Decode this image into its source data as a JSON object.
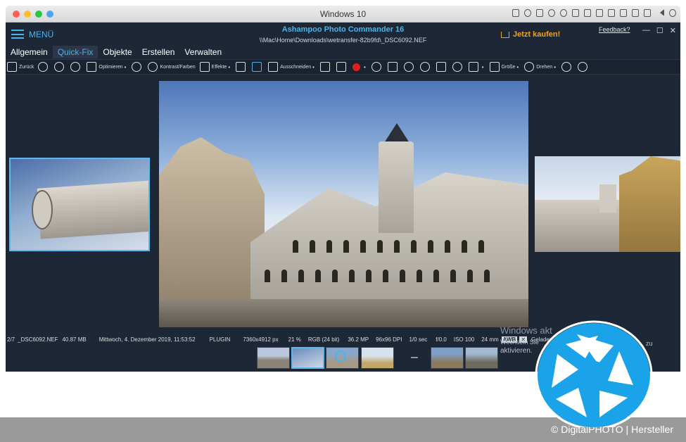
{
  "mac_window": {
    "title": "Windows 10"
  },
  "app": {
    "menu_label": "MENÜ",
    "title": "Ashampoo Photo Commander 16",
    "path": "\\\\Mac\\Home\\Downloads\\wetransfer-82b9fd\\_DSC6092.NEF",
    "buy_label": "Jetzt kaufen!",
    "feedback_label": "Feedback?",
    "tabs": [
      "Allgemein",
      "Quick-Fix",
      "Objekte",
      "Erstellen",
      "Verwalten"
    ],
    "active_tab": "Quick-Fix"
  },
  "toolbar": {
    "back": "Zurück",
    "optimize": "Optimieren",
    "contrast": "Kontrast/Farben",
    "effects": "Effekte",
    "crop": "Ausschneiden",
    "size": "Größe",
    "rotate": "Drehen"
  },
  "status": {
    "index": "2/7",
    "filename": "_DSC6092.NEF",
    "filesize": "40.87 MB",
    "date": "Mittwoch, 4. Dezember 2019, 11:53:52",
    "plugin": "PLUGIN",
    "dimensions": "7360x4912 px",
    "zoom": "21 %",
    "color": "RGB (24 bit)",
    "megapixels": "36.2 MP",
    "dpi": "96x96 DPI",
    "shutter": "1/0 sec",
    "aperture": "f/0.0",
    "iso": "ISO 100",
    "focal": "24 mm",
    "wb": "AWB",
    "loaded": "Gelader"
  },
  "activation": {
    "title": "Windows akt",
    "line1": "Wechseln Sie",
    "line2": "aktivieren.",
    "suffix": "zu"
  },
  "credit": "© DigitalPHOTO | Hersteller",
  "colors": {
    "accent": "#4ab4ea",
    "buy": "#f0a020",
    "panel": "#1e2736",
    "logo": "#1aa3e8"
  }
}
